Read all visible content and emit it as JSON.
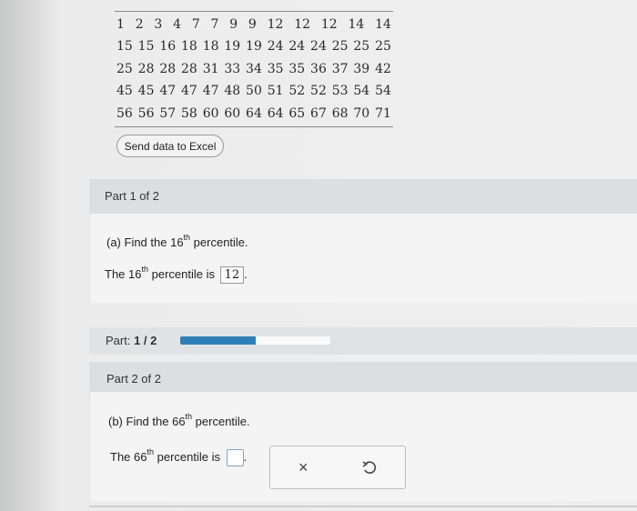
{
  "data_rows": [
    [
      "1",
      "2",
      "3",
      "4",
      "7",
      "7",
      "9",
      "9",
      "12",
      "12",
      "12",
      "14",
      "14"
    ],
    [
      "15",
      "15",
      "16",
      "18",
      "18",
      "19",
      "19",
      "24",
      "24",
      "24",
      "25",
      "25",
      "25"
    ],
    [
      "25",
      "28",
      "28",
      "28",
      "31",
      "33",
      "34",
      "35",
      "35",
      "36",
      "37",
      "39",
      "42"
    ],
    [
      "45",
      "45",
      "47",
      "47",
      "47",
      "48",
      "50",
      "51",
      "52",
      "52",
      "53",
      "54",
      "54"
    ],
    [
      "56",
      "56",
      "57",
      "58",
      "60",
      "60",
      "64",
      "64",
      "65",
      "67",
      "68",
      "70",
      "71"
    ]
  ],
  "excel_button_label": "Send data to Excel",
  "part1": {
    "header": "Part 1 of 2",
    "q_prefix": "(a) Find the 16",
    "q_sup": "th",
    "q_suffix": " percentile.",
    "a_prefix": "The 16",
    "a_sup": "th",
    "a_middle": " percentile is ",
    "answer": "12",
    "a_end": "."
  },
  "progress": {
    "label_prefix": "Part: ",
    "label_value": "1 / 2",
    "fraction": 0.5,
    "color": "#2f7fb7"
  },
  "part2": {
    "header": "Part 2 of 2",
    "q_prefix": "(b) Find the 66",
    "q_sup": "th",
    "q_suffix": " percentile.",
    "a_prefix": "The 66",
    "a_sup": "th",
    "a_middle": " percentile is ",
    "a_end": "."
  },
  "tools": {
    "clear_icon": "close-icon",
    "clear_glyph": "×",
    "undo_icon": "undo-icon"
  }
}
